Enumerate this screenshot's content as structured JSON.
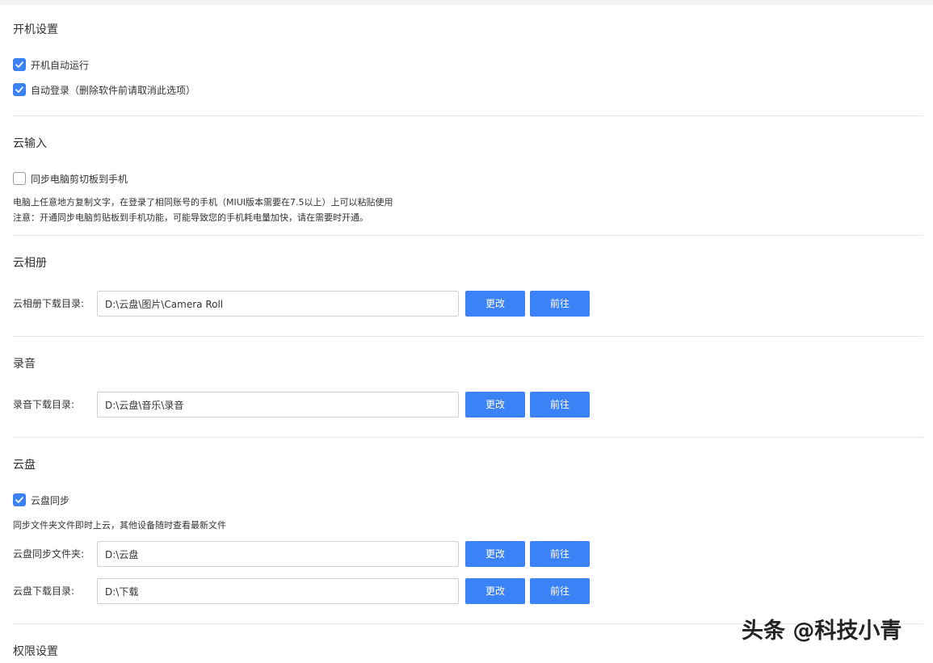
{
  "sections": {
    "startup": {
      "title": "开机设置",
      "autorun_label": "开机自动运行",
      "autorun_checked": true,
      "autologin_label": "自动登录（删除软件前请取消此选项）",
      "autologin_checked": true
    },
    "cloud_input": {
      "title": "云输入",
      "sync_clipboard_label": "同步电脑剪切板到手机",
      "sync_clipboard_checked": false,
      "desc_line1": "电脑上任意地方复制文字，在登录了相同账号的手机（MIUI版本需要在7.5以上）上可以粘贴使用",
      "desc_line2": "注意：开通同步电脑剪贴板到手机功能，可能导致您的手机耗电量加快，请在需要时开通。"
    },
    "cloud_album": {
      "title": "云相册",
      "download_dir_label": "云相册下载目录:",
      "download_dir_value": "D:\\云盘\\图片\\Camera Roll",
      "change_label": "更改",
      "goto_label": "前往"
    },
    "recording": {
      "title": "录音",
      "download_dir_label": "录音下载目录:",
      "download_dir_value": "D:\\云盘\\音乐\\录音",
      "change_label": "更改",
      "goto_label": "前往"
    },
    "cloud_drive": {
      "title": "云盘",
      "sync_label": "云盘同步",
      "sync_checked": true,
      "desc": "同步文件夹文件即时上云，其他设备随时查看最新文件",
      "sync_folder_label": "云盘同步文件夹:",
      "sync_folder_value": "D:\\云盘",
      "download_dir_label": "云盘下载目录:",
      "download_dir_value": "D:\\下载",
      "change_label": "更改",
      "goto_label": "前往"
    },
    "permissions": {
      "title": "权限设置"
    }
  },
  "watermark": "头条 @科技小青",
  "colors": {
    "accent": "#3b82f6",
    "divider": "#e8e8e8",
    "text": "#333333"
  }
}
